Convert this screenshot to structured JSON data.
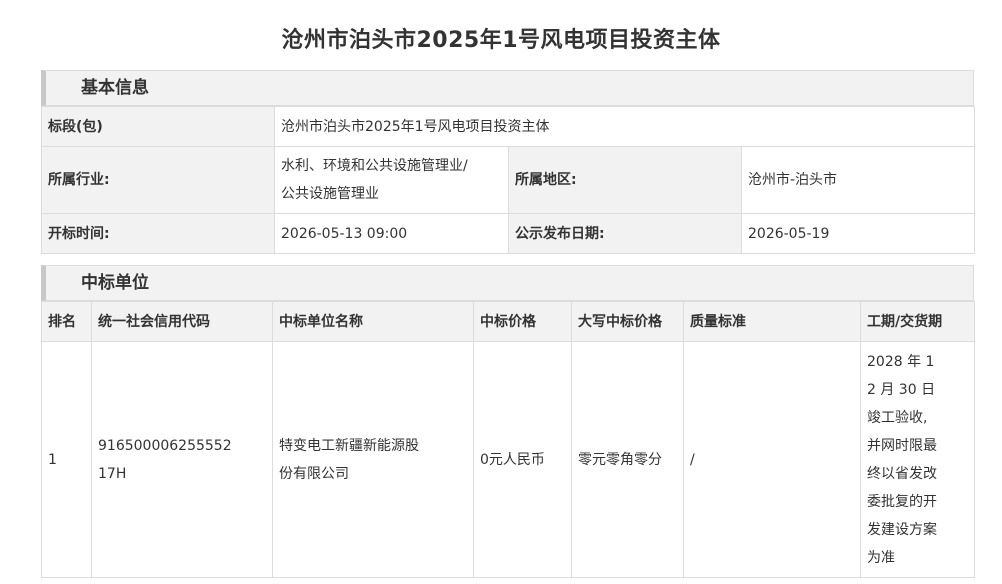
{
  "page_title": "沧州市泊头市2025年1号风电项目投资主体",
  "basic_info": {
    "header": "基本信息",
    "section_label": "标段(包)",
    "section_value": "沧州市泊头市2025年1号风电项目投资主体",
    "industry_label": "所属行业:",
    "industry_value_line1": "水利、环境和公共设施管理业/",
    "industry_value_line2": "公共设施管理业",
    "region_label": "所属地区:",
    "region_value": "沧州市-泊头市",
    "open_time_label": "开标时间:",
    "open_time_value": "2026-05-13 09:00",
    "publish_date_label": "公示发布日期:",
    "publish_date_value": "2026-05-19"
  },
  "winner": {
    "header": "中标单位",
    "columns": [
      "排名",
      "统一社会信用代码",
      "中标单位名称",
      "中标价格",
      "大写中标价格",
      "质量标准",
      "工期/交货期"
    ],
    "rows": [
      {
        "rank": "1",
        "credit_code_line1": "916500006255552",
        "credit_code_line2": "17H",
        "name_line1": "特变电工新疆新能源股",
        "name_line2": "份有限公司",
        "price": "0元人民币",
        "price_words": "零元零角零分",
        "quality": "/",
        "period_lines": [
          "2028 年 1",
          "2 月 30 日",
          "竣工验收,",
          "并网时限最",
          "终以省发改",
          "委批复的开",
          "发建设方案",
          "为准"
        ]
      }
    ]
  }
}
